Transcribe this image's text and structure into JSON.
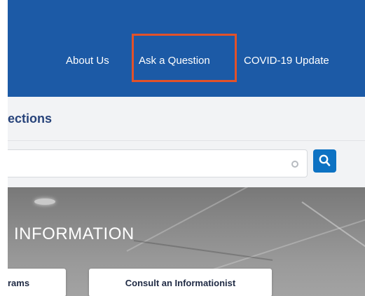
{
  "nav": {
    "links": [
      {
        "label": "About Us"
      },
      {
        "label": "Ask a Question"
      },
      {
        "label": "COVID-19 Update"
      }
    ],
    "highlighted_item": "Ask a Question",
    "highlight_color": "#e2522a",
    "background_color": "#1c5aa6"
  },
  "section": {
    "title": "ections"
  },
  "search": {
    "value": "",
    "placeholder": "",
    "clear_icon": "circle-icon",
    "button_icon": "search-icon",
    "button_color": "#0d72c3"
  },
  "hero": {
    "title": "INFORMATION",
    "buttons": [
      {
        "label": "rams"
      },
      {
        "label": "Consult an Informationist"
      }
    ]
  }
}
